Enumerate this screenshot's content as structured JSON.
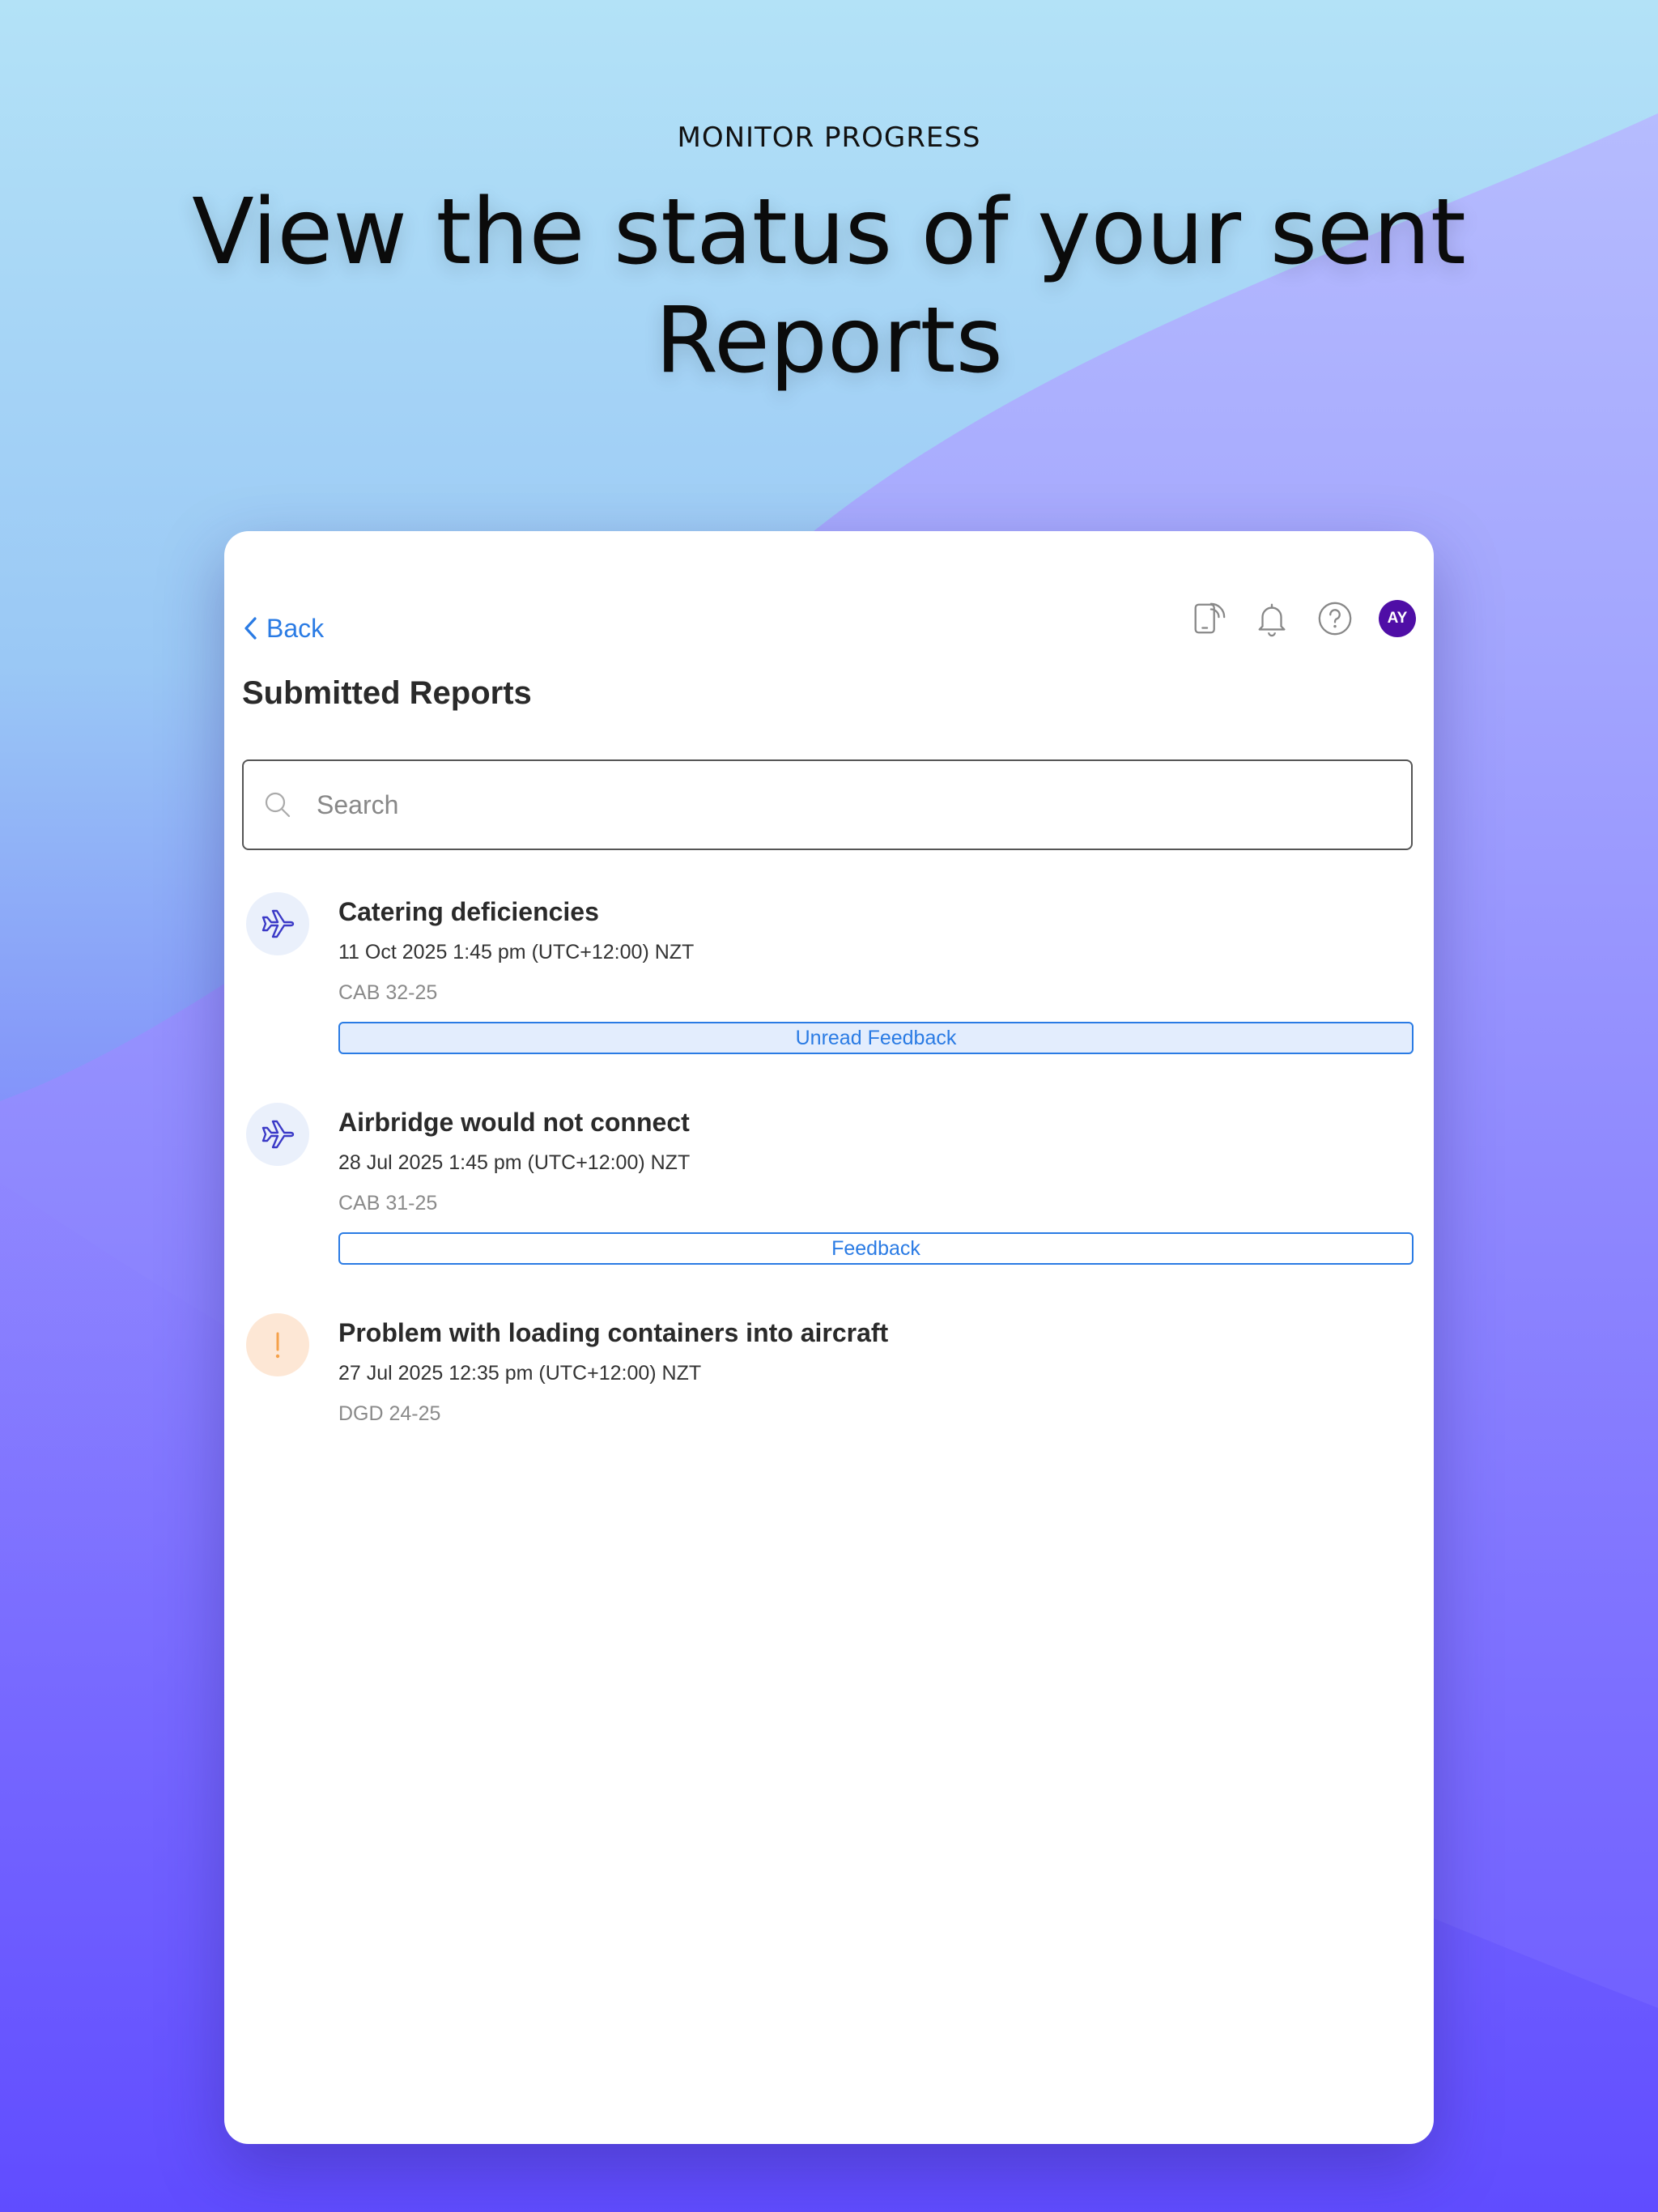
{
  "promo": {
    "eyebrow": "MONITOR PROGRESS",
    "headline": "View the status of your sent Reports"
  },
  "colors": {
    "accent": "#2a7be4",
    "avatar_bg": "#4f0ea6",
    "plane_icon": "#3b3ac7",
    "alert_icon": "#f5a14a"
  },
  "header": {
    "back_label": "Back",
    "icons": [
      "device-signal-icon",
      "bell-icon",
      "help-icon"
    ],
    "avatar_initials": "AY"
  },
  "page": {
    "title": "Submitted Reports"
  },
  "search": {
    "placeholder": "Search",
    "value": ""
  },
  "reports": [
    {
      "icon": "plane-icon",
      "title": "Catering deficiencies",
      "date": "11 Oct 2025 1:45 pm  (UTC+12:00) NZT",
      "code": "CAB 32-25",
      "feedback_label": "Unread Feedback"
    },
    {
      "icon": "plane-icon",
      "title": "Airbridge would not connect",
      "date": "28 Jul 2025 1:45 pm  (UTC+12:00) NZT",
      "code": "CAB 31-25",
      "feedback_label": "Feedback"
    },
    {
      "icon": "alert-icon",
      "title": "Problem with loading containers into aircraft",
      "date": "27 Jul 2025 12:35 pm  (UTC+12:00) NZT",
      "code": "DGD 24-25"
    }
  ]
}
